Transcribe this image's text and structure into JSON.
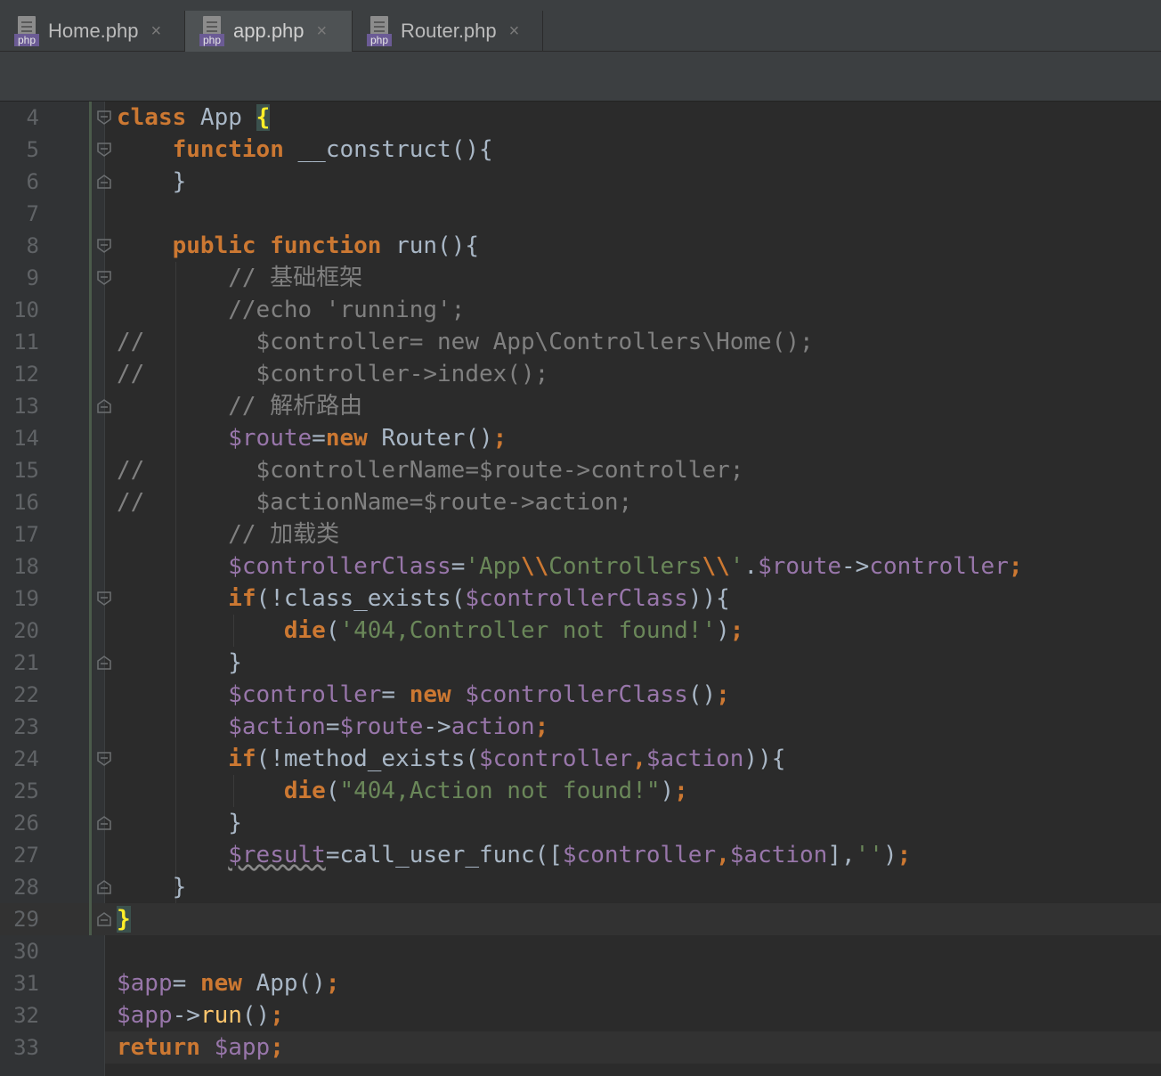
{
  "tabs": [
    {
      "label": "Home.php",
      "icon": "php-file-icon",
      "badge": "php",
      "active": false
    },
    {
      "label": "app.php",
      "icon": "php-file-icon",
      "badge": "php",
      "active": true
    },
    {
      "label": "Router.php",
      "icon": "php-file-icon",
      "badge": "php",
      "active": false
    }
  ],
  "tab_close_glyph": "×",
  "colors": {
    "keyword": "#cc7832",
    "variable": "#9876aa",
    "string": "#6a8759",
    "comment": "#808080",
    "text": "#a9b7c6",
    "line_number": "#606366",
    "background": "#2b2b2b",
    "brace_match": "#ffef28"
  },
  "editor": {
    "line_numbers": [
      "4",
      "5",
      "6",
      "7",
      "8",
      "9",
      "10",
      "11",
      "12",
      "13",
      "14",
      "15",
      "16",
      "17",
      "18",
      "19",
      "20",
      "21",
      "22",
      "23",
      "24",
      "25",
      "26",
      "27",
      "28",
      "29",
      "30",
      "31",
      "32",
      "33"
    ],
    "lines": [
      [
        {
          "t": "class",
          "c": "kw"
        },
        {
          "t": " App ",
          "c": "plain"
        },
        {
          "t": "{",
          "c": "brace-hl"
        }
      ],
      [
        {
          "t": "    ",
          "c": "plain"
        },
        {
          "t": "function",
          "c": "kw"
        },
        {
          "t": " __construct(){",
          "c": "plain"
        }
      ],
      [
        {
          "t": "    }",
          "c": "plain"
        }
      ],
      [],
      [
        {
          "t": "    ",
          "c": "plain"
        },
        {
          "t": "public",
          "c": "kw"
        },
        {
          "t": " ",
          "c": "plain"
        },
        {
          "t": "function",
          "c": "kw"
        },
        {
          "t": " run(){",
          "c": "plain"
        }
      ],
      [
        {
          "t": "        // 基础框架",
          "c": "cm"
        }
      ],
      [
        {
          "t": "        //echo 'running';",
          "c": "cm"
        }
      ],
      [
        {
          "t": "//        $controller= new App\\Controllers\\Home();",
          "c": "cm"
        }
      ],
      [
        {
          "t": "//        $controller->index();",
          "c": "cm"
        }
      ],
      [
        {
          "t": "        // 解析路由",
          "c": "cm"
        }
      ],
      [
        {
          "t": "        ",
          "c": "plain"
        },
        {
          "t": "$route",
          "c": "var"
        },
        {
          "t": "=",
          "c": "plain"
        },
        {
          "t": "new",
          "c": "kw"
        },
        {
          "t": " Router()",
          "c": "plain"
        },
        {
          "t": ";",
          "c": "kw"
        }
      ],
      [
        {
          "t": "//        $controllerName=$route->controller;",
          "c": "cm"
        }
      ],
      [
        {
          "t": "//        $actionName=$route->action;",
          "c": "cm"
        }
      ],
      [
        {
          "t": "        // 加载类",
          "c": "cm"
        }
      ],
      [
        {
          "t": "        ",
          "c": "plain"
        },
        {
          "t": "$controllerClass",
          "c": "var"
        },
        {
          "t": "=",
          "c": "plain"
        },
        {
          "t": "'App",
          "c": "str"
        },
        {
          "t": "\\\\",
          "c": "kw"
        },
        {
          "t": "Controllers",
          "c": "str"
        },
        {
          "t": "\\\\",
          "c": "kw"
        },
        {
          "t": "'",
          "c": "str"
        },
        {
          "t": ".",
          "c": "plain"
        },
        {
          "t": "$route",
          "c": "var"
        },
        {
          "t": "->",
          "c": "plain"
        },
        {
          "t": "controller",
          "c": "var"
        },
        {
          "t": ";",
          "c": "kw"
        }
      ],
      [
        {
          "t": "        ",
          "c": "plain"
        },
        {
          "t": "if",
          "c": "kw"
        },
        {
          "t": "(!class_exists(",
          "c": "plain"
        },
        {
          "t": "$controllerClass",
          "c": "var"
        },
        {
          "t": ")){",
          "c": "plain"
        }
      ],
      [
        {
          "t": "            ",
          "c": "plain"
        },
        {
          "t": "die",
          "c": "kw"
        },
        {
          "t": "(",
          "c": "plain"
        },
        {
          "t": "'404,Controller not found!'",
          "c": "str"
        },
        {
          "t": ")",
          "c": "plain"
        },
        {
          "t": ";",
          "c": "kw"
        }
      ],
      [
        {
          "t": "        }",
          "c": "plain"
        }
      ],
      [
        {
          "t": "        ",
          "c": "plain"
        },
        {
          "t": "$controller",
          "c": "var"
        },
        {
          "t": "= ",
          "c": "plain"
        },
        {
          "t": "new",
          "c": "kw"
        },
        {
          "t": " ",
          "c": "plain"
        },
        {
          "t": "$controllerClass",
          "c": "var"
        },
        {
          "t": "()",
          "c": "plain"
        },
        {
          "t": ";",
          "c": "kw"
        }
      ],
      [
        {
          "t": "        ",
          "c": "plain"
        },
        {
          "t": "$action",
          "c": "var"
        },
        {
          "t": "=",
          "c": "plain"
        },
        {
          "t": "$route",
          "c": "var"
        },
        {
          "t": "->",
          "c": "plain"
        },
        {
          "t": "action",
          "c": "var"
        },
        {
          "t": ";",
          "c": "kw"
        }
      ],
      [
        {
          "t": "        ",
          "c": "plain"
        },
        {
          "t": "if",
          "c": "kw"
        },
        {
          "t": "(!method_exists(",
          "c": "plain"
        },
        {
          "t": "$controller",
          "c": "var"
        },
        {
          "t": ",",
          "c": "kw"
        },
        {
          "t": "$action",
          "c": "var"
        },
        {
          "t": ")){",
          "c": "plain"
        }
      ],
      [
        {
          "t": "            ",
          "c": "plain"
        },
        {
          "t": "die",
          "c": "kw"
        },
        {
          "t": "(",
          "c": "plain"
        },
        {
          "t": "\"404,Action not found!\"",
          "c": "str"
        },
        {
          "t": ")",
          "c": "plain"
        },
        {
          "t": ";",
          "c": "kw"
        }
      ],
      [
        {
          "t": "        }",
          "c": "plain"
        }
      ],
      [
        {
          "t": "        ",
          "c": "plain"
        },
        {
          "t": "$result",
          "c": "var wavy"
        },
        {
          "t": "=call_user_func([",
          "c": "plain"
        },
        {
          "t": "$controller",
          "c": "var"
        },
        {
          "t": ",",
          "c": "kw"
        },
        {
          "t": "$action",
          "c": "var"
        },
        {
          "t": "],",
          "c": "plain"
        },
        {
          "t": "''",
          "c": "str"
        },
        {
          "t": ")",
          "c": "plain"
        },
        {
          "t": ";",
          "c": "kw"
        }
      ],
      [
        {
          "t": "    }",
          "c": "plain"
        }
      ],
      [
        {
          "t": "}",
          "c": "brace-hl"
        }
      ],
      [],
      [
        {
          "t": "$app",
          "c": "var"
        },
        {
          "t": "= ",
          "c": "plain"
        },
        {
          "t": "new",
          "c": "kw"
        },
        {
          "t": " App()",
          "c": "plain"
        },
        {
          "t": ";",
          "c": "kw"
        }
      ],
      [
        {
          "t": "$app",
          "c": "var"
        },
        {
          "t": "->",
          "c": "plain"
        },
        {
          "t": "run",
          "c": "fn"
        },
        {
          "t": "()",
          "c": "plain"
        },
        {
          "t": ";",
          "c": "kw"
        }
      ],
      [
        {
          "t": "return",
          "c": "kw"
        },
        {
          "t": " ",
          "c": "plain"
        },
        {
          "t": "$app",
          "c": "var"
        },
        {
          "t": ";",
          "c": "kw"
        }
      ]
    ],
    "fold_markers": {
      "4": "open",
      "5": "open",
      "6": "close",
      "8": "open",
      "9": "open",
      "13": "close",
      "19": "open",
      "21": "close",
      "24": "open",
      "26": "close",
      "28": "close",
      "29": "close"
    }
  }
}
